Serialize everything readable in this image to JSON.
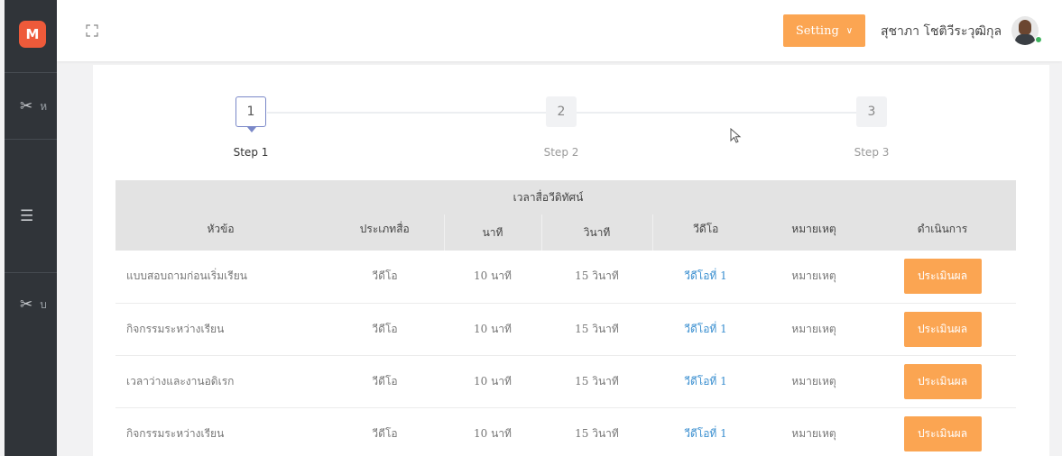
{
  "brand": {
    "logo_letter": "M",
    "color": "#ee5a3a"
  },
  "sidebar": {
    "items": [
      {
        "icon": "scissors-icon",
        "label": "ห"
      },
      {
        "icon": "menu-icon",
        "label": ""
      },
      {
        "icon": "scissors-icon",
        "label": "บ"
      }
    ]
  },
  "topbar": {
    "setting_label": "Setting",
    "user_name": "สุชาภา โชติวีระวุฒิกุล"
  },
  "stepper": {
    "steps": [
      {
        "number": "1",
        "label": "Step 1",
        "active": true
      },
      {
        "number": "2",
        "label": "Step 2",
        "active": false
      },
      {
        "number": "3",
        "label": "Step 3",
        "active": false
      }
    ]
  },
  "table": {
    "group_header": "เวลาสื่อวีดิทัศน์",
    "headers": {
      "topic": "หัวข้อ",
      "media_type": "ประเภทสื่อ",
      "minutes": "นาที",
      "seconds": "วินาที",
      "video": "วีดีโอ",
      "note": "หมายเหตุ",
      "action": "ดำเนินการ"
    },
    "rows": [
      {
        "topic": "แบบสอบถามก่อนเริ่มเรียน",
        "media_type": "วีดีโอ",
        "minutes": "10 นาที",
        "seconds": "15 วินาที",
        "video": "วีดีโอที่ 1",
        "note": "หมายเหตุ",
        "action": "ประเมินผล"
      },
      {
        "topic": "กิจกรรมระหว่างเรียน",
        "media_type": "วีดีโอ",
        "minutes": "10 นาที",
        "seconds": "15 วินาที",
        "video": "วีดีโอที่ 1",
        "note": "หมายเหตุ",
        "action": "ประเมินผล"
      },
      {
        "topic": "เวลาว่างและงานอดิเรก",
        "media_type": "วีดีโอ",
        "minutes": "10 นาที",
        "seconds": "15 วินาที",
        "video": "วีดีโอที่ 1",
        "note": "หมายเหตุ",
        "action": "ประเมินผล"
      },
      {
        "topic": "กิจกรรมระหว่างเรียน",
        "media_type": "วีดีโอ",
        "minutes": "10 นาที",
        "seconds": "15 วินาที",
        "video": "วีดีโอที่ 1",
        "note": "หมายเหตุ",
        "action": "ประเมินผล"
      }
    ]
  },
  "colors": {
    "accent": "#fba552",
    "link": "#3a8fd0",
    "sidebar": "#303439",
    "step_active": "#7a88c8"
  }
}
